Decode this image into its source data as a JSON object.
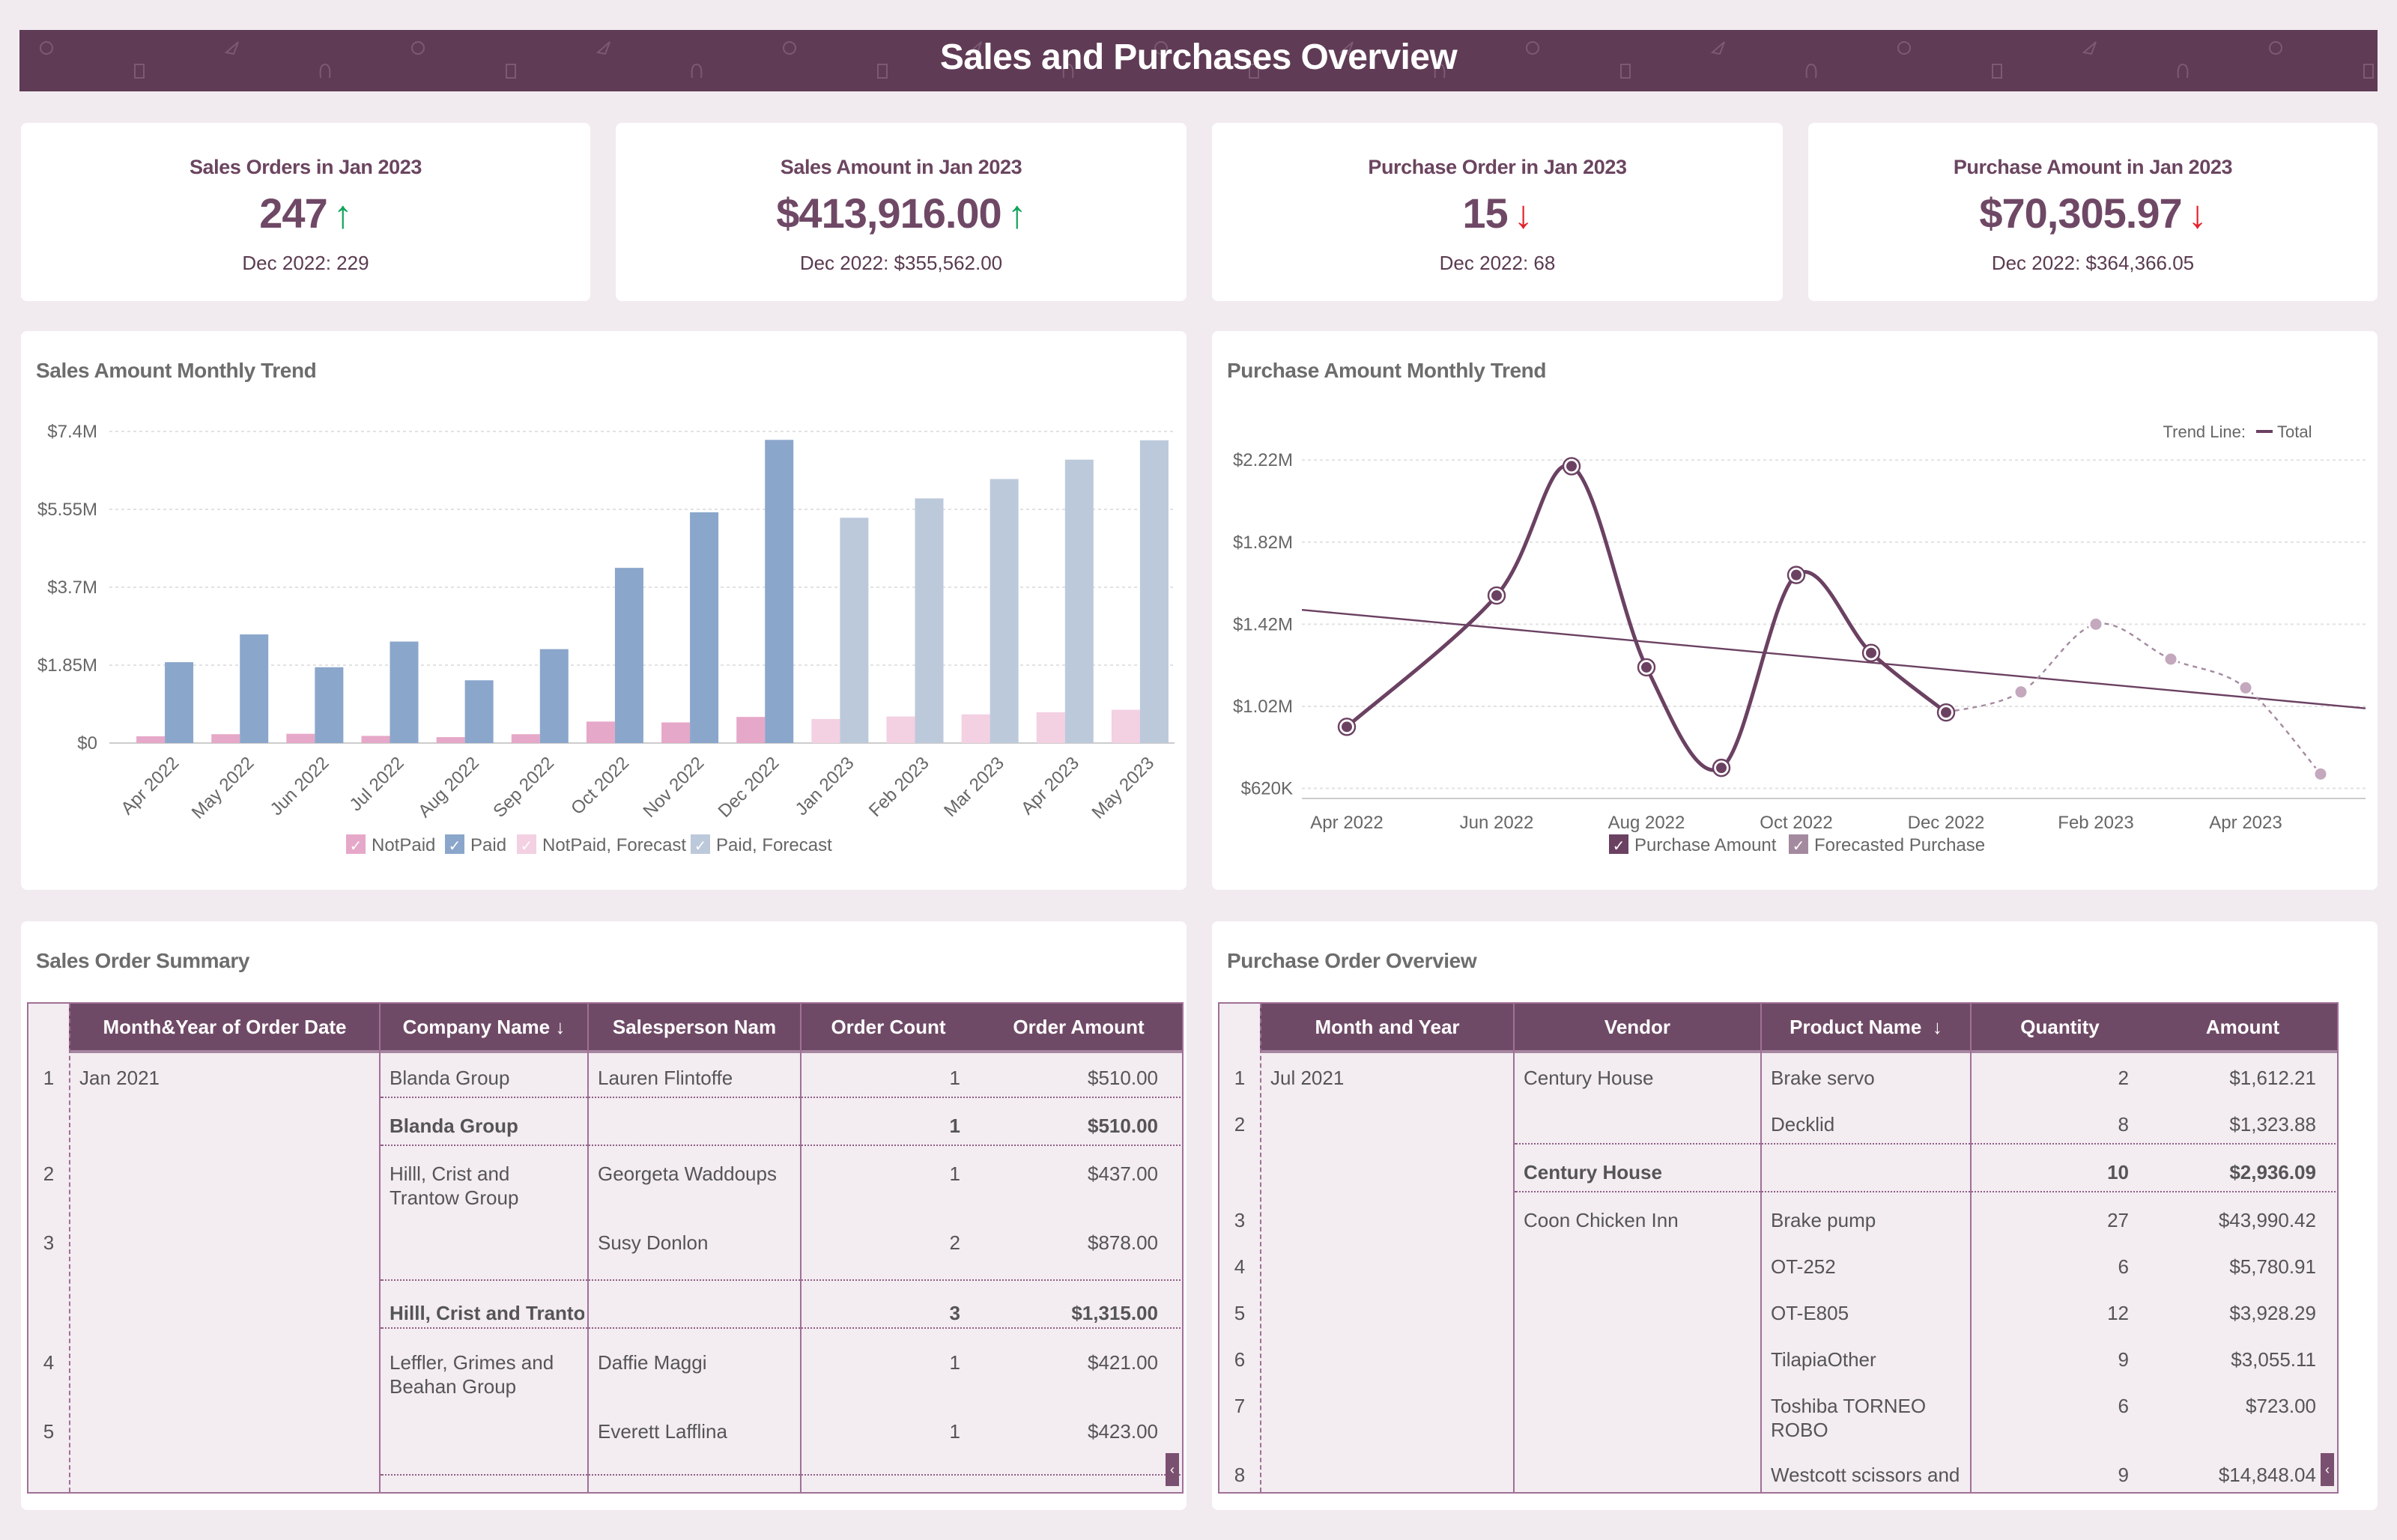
{
  "header": {
    "title": "Sales and Purchases Overview"
  },
  "kpis": [
    {
      "title": "Sales Orders in Jan 2023",
      "value": "247",
      "trend": "up",
      "trend_icon": "↑",
      "previous": "Dec 2022: 229"
    },
    {
      "title": "Sales Amount in Jan 2023",
      "value": "$413,916.00",
      "trend": "up",
      "trend_icon": "↑",
      "previous": "Dec 2022: $355,562.00"
    },
    {
      "title": "Purchase Order in Jan 2023",
      "value": "15",
      "trend": "down",
      "trend_icon": "↓",
      "previous": "Dec 2022: 68"
    },
    {
      "title": "Purchase Amount in Jan 2023",
      "value": "$70,305.97",
      "trend": "down",
      "trend_icon": "↓",
      "previous": "Dec 2022: $364,366.05"
    }
  ],
  "colors": {
    "brand": "#5f3b55",
    "up": "#11a35a",
    "down": "#e3222c",
    "notpaid": "#e6a8c8",
    "paid": "#8ba6cb",
    "notpaid_forecast": "#f3d0e2",
    "paid_forecast": "#bcc9db",
    "line": "#6b4162",
    "forecast_line": "#a48a9f"
  },
  "chart_data": [
    {
      "id": "sales",
      "type": "bar",
      "title": "Sales Amount Monthly Trend",
      "xlabel": "",
      "ylabel": "",
      "categories": [
        "Apr 2022",
        "May 2022",
        "Jun 2022",
        "Jul 2022",
        "Aug 2022",
        "Sep 2022",
        "Oct 2022",
        "Nov 2022",
        "Dec 2022",
        "Jan 2023",
        "Feb 2023",
        "Mar 2023",
        "Apr 2023",
        "May 2023"
      ],
      "yticks": [
        0,
        1.85,
        3.7,
        5.55,
        7.4
      ],
      "ytick_labels": [
        "$0",
        "$1.85M",
        "$3.7M",
        "$5.55M",
        "$7.4M"
      ],
      "ylim": [
        0,
        7.4
      ],
      "units": "millions USD",
      "grid": true,
      "legend_position": "bottom",
      "legend": [
        "NotPaid",
        "Paid",
        "NotPaid, Forecast",
        "Paid, Forecast"
      ],
      "forecast_start_index": 9,
      "series": [
        {
          "name": "NotPaid",
          "values": [
            0.16,
            0.21,
            0.22,
            0.17,
            0.14,
            0.21,
            0.51,
            0.49,
            0.62,
            0.57,
            0.63,
            0.68,
            0.73,
            0.79
          ]
        },
        {
          "name": "Paid",
          "values": [
            1.92,
            2.58,
            1.8,
            2.41,
            1.49,
            2.23,
            4.16,
            5.48,
            7.2,
            5.35,
            5.81,
            6.27,
            6.73,
            7.19
          ]
        }
      ]
    },
    {
      "id": "purchase",
      "type": "line",
      "title": "Purchase Amount Monthly Trend",
      "xlabel": "",
      "ylabel": "",
      "x": [
        "Apr 2022",
        "Jun 2022",
        "Jul 2022",
        "Aug 2022",
        "Sep 2022",
        "Oct 2022",
        "Nov 2022",
        "Dec 2022",
        "Jan 2023",
        "Feb 2023",
        "Mar 2023",
        "Apr 2023",
        "May 2023"
      ],
      "x_month_index": [
        0,
        2,
        3,
        4,
        5,
        6,
        7,
        8,
        9,
        10,
        11,
        12,
        13
      ],
      "xtick_labels": [
        "Apr 2022",
        "Jun 2022",
        "Aug 2022",
        "Oct 2022",
        "Dec 2022",
        "Feb 2023",
        "Apr 2023"
      ],
      "xtick_month_index": [
        0,
        2,
        4,
        6,
        8,
        10,
        12
      ],
      "yticks": [
        0.62,
        1.02,
        1.42,
        1.82,
        2.22
      ],
      "ytick_labels": [
        "$620K",
        "$1.02M",
        "$1.42M",
        "$1.82M",
        "$2.22M"
      ],
      "ylim": [
        0.6,
        2.25
      ],
      "units": "millions USD",
      "grid": true,
      "legend_position": "bottom",
      "legend": [
        "Purchase Amount",
        "Forecasted Purchase"
      ],
      "trend_legend_label": "Trend Line:",
      "trend_legend_item": "Total",
      "series": [
        {
          "name": "Purchase Amount",
          "month_index": [
            0,
            2,
            3,
            4,
            5,
            6,
            7,
            8
          ],
          "values": [
            0.92,
            1.56,
            2.19,
            1.21,
            0.72,
            1.66,
            1.28,
            0.99
          ]
        },
        {
          "name": "Forecasted Purchase",
          "month_index": [
            8,
            9,
            10,
            11,
            12,
            13
          ],
          "values": [
            0.99,
            1.09,
            1.42,
            1.25,
            1.11,
            0.69
          ]
        }
      ],
      "trend_line": {
        "name": "Total",
        "start": {
          "month_index": -0.6,
          "value": 1.49
        },
        "end": {
          "month_index": 13.6,
          "value": 1.01
        }
      }
    }
  ],
  "sales_table": {
    "title": "Sales Order Summary",
    "columns": [
      "Month&Year of Order Date",
      "Company Name",
      "Salesperson Nam",
      "Order Count",
      "Order Amount"
    ],
    "sort_icon": "↓",
    "month": "Jan 2021",
    "rows": [
      {
        "num": "1",
        "company": "Blanda Group",
        "salesperson": "Lauren Flintoffe",
        "count": "1",
        "amount": "$510.00"
      },
      {
        "num": "",
        "company": "Blanda Group",
        "salesperson": "",
        "count": "1",
        "amount": "$510.00",
        "subtotal": true
      },
      {
        "num": "2",
        "company": "Hilll, Crist and Trantow Group",
        "salesperson": "Georgeta Waddoups",
        "count": "1",
        "amount": "$437.00"
      },
      {
        "num": "3",
        "company": "",
        "salesperson": "Susy Donlon",
        "count": "2",
        "amount": "$878.00"
      },
      {
        "num": "",
        "company": "Hilll, Crist and Trantow",
        "salesperson": "",
        "count": "3",
        "amount": "$1,315.00",
        "subtotal": true
      },
      {
        "num": "4",
        "company": "Leffler, Grimes and Beahan Group",
        "salesperson": "Daffie Maggi",
        "count": "1",
        "amount": "$421.00"
      },
      {
        "num": "5",
        "company": "",
        "salesperson": "Everett Lafflina",
        "count": "1",
        "amount": "$423.00"
      }
    ]
  },
  "purchase_table": {
    "title": "Purchase Order Overview",
    "columns": [
      "Month and Year",
      "Vendor",
      "Product Name",
      "Quantity",
      "Amount"
    ],
    "sort_icon": "↓",
    "month": "Jul 2021",
    "rows": [
      {
        "num": "1",
        "vendor": "Century House",
        "product": "Brake servo",
        "qty": "2",
        "amount": "$1,612.21"
      },
      {
        "num": "2",
        "vendor": "",
        "product": "Decklid",
        "qty": "8",
        "amount": "$1,323.88"
      },
      {
        "num": "",
        "vendor": "Century House",
        "product": "",
        "qty": "10",
        "amount": "$2,936.09",
        "subtotal": true
      },
      {
        "num": "3",
        "vendor": "Coon Chicken Inn",
        "product": "Brake pump",
        "qty": "27",
        "amount": "$43,990.42"
      },
      {
        "num": "4",
        "vendor": "",
        "product": "OT-252",
        "qty": "6",
        "amount": "$5,780.91"
      },
      {
        "num": "5",
        "vendor": "",
        "product": "OT-E805",
        "qty": "12",
        "amount": "$3,928.29"
      },
      {
        "num": "6",
        "vendor": "",
        "product": "TilapiaOther",
        "qty": "9",
        "amount": "$3,055.11"
      },
      {
        "num": "7",
        "vendor": "",
        "product": "Toshiba TORNEO ROBO",
        "qty": "6",
        "amount": "$723.00"
      },
      {
        "num": "8",
        "vendor": "",
        "product": "Westcott scissors and",
        "qty": "9",
        "amount": "$14,848.04"
      }
    ]
  },
  "scroll_icon": "‹"
}
